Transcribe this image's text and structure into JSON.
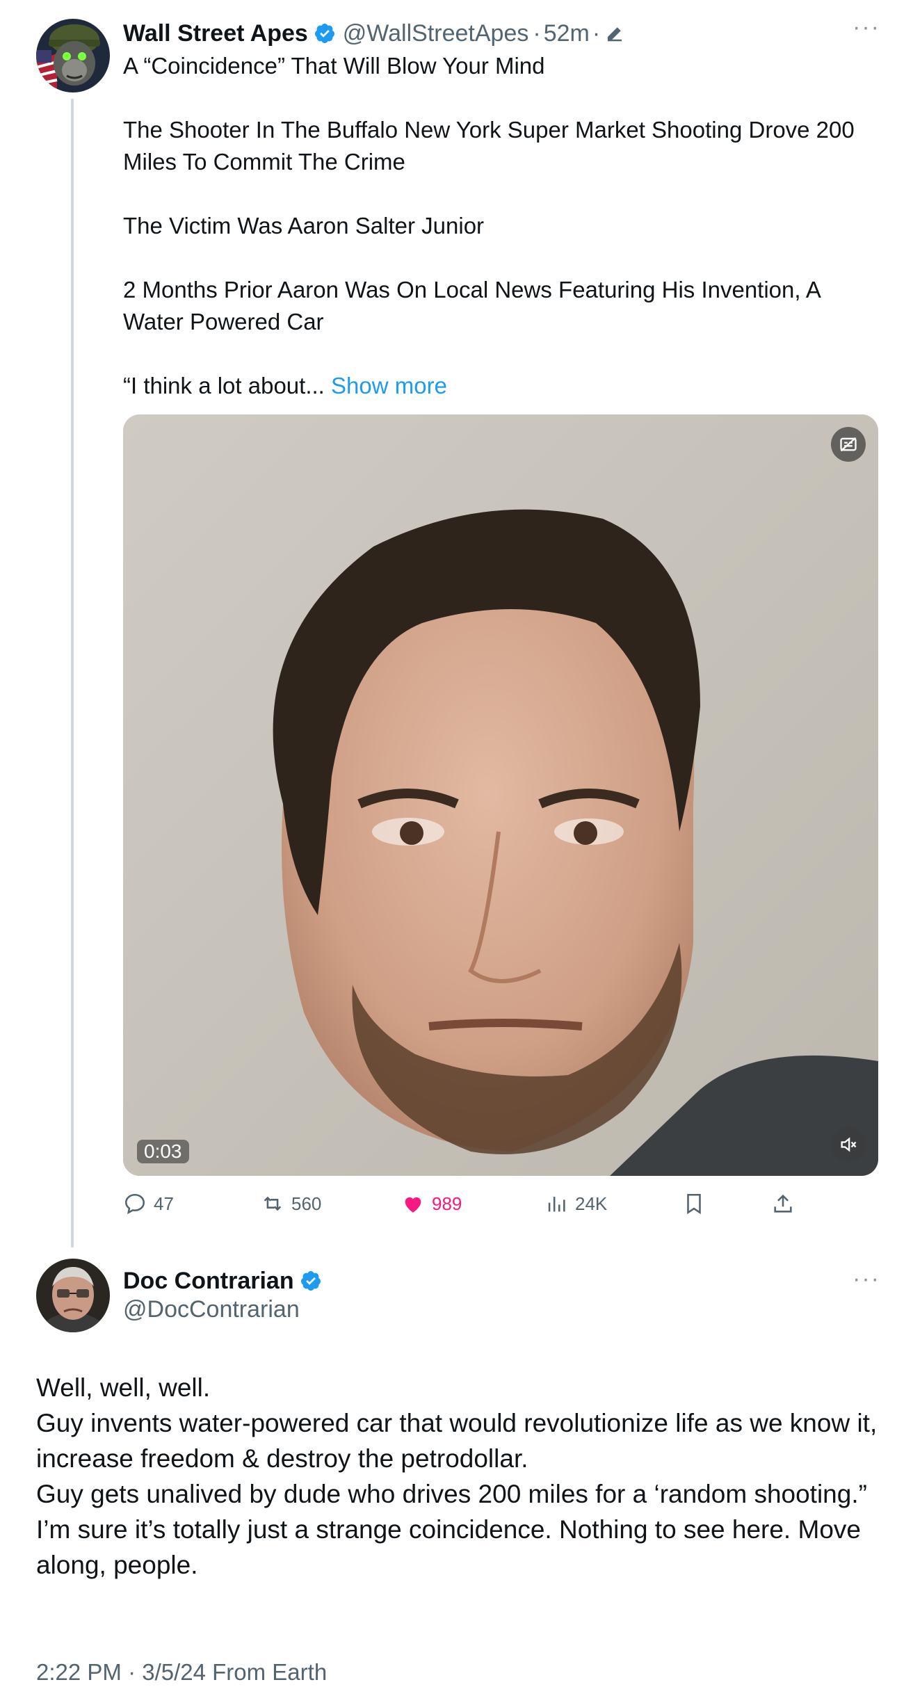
{
  "original_tweet": {
    "display_name": "Wall Street Apes",
    "handle": "@WallStreetApes",
    "separator": "·",
    "time": "52m",
    "lines": [
      "A “Coincidence” That Will Blow Your Mind",
      "",
      "The Shooter In The Buffalo New York Super Market Shooting Drove 200 Miles To Commit The Crime",
      "",
      "The Victim Was Aaron Salter Junior",
      "",
      "2 Months Prior Aaron Was On Local News Featuring His Invention, A Water Powered Car",
      ""
    ],
    "truncated_line": "“I think a lot about...",
    "show_more": "Show more",
    "video": {
      "timecode": "0:03"
    },
    "actions": {
      "replies": "47",
      "reposts": "560",
      "likes": "989",
      "views": "24K"
    }
  },
  "reply_tweet": {
    "display_name": "Doc Contrarian",
    "handle": "@DocContrarian",
    "lines": [
      "Well, well, well.",
      "Guy invents water-powered car that would revolutionize life as we know it, increase freedom & destroy the petrodollar.",
      "Guy gets unalived by dude who drives 200 miles for a ‘random shooting.”",
      "I’m sure it’s totally just a strange coincidence. Nothing to see here. Move along, people."
    ],
    "timestamp": "2:22 PM · 3/5/24 From Earth"
  },
  "more_label": "···",
  "colors": {
    "verified": "#1d9bf0",
    "link": "#1d9bf0",
    "like": "#f91880",
    "secondary_text": "#536471",
    "thread_line": "#cfd9de"
  },
  "icons": [
    "verified-badge-icon",
    "edit-icon",
    "more-icon",
    "reply-icon",
    "repost-icon",
    "heart-icon",
    "views-icon",
    "bookmark-icon",
    "share-icon",
    "caption-icon",
    "mute-icon"
  ]
}
